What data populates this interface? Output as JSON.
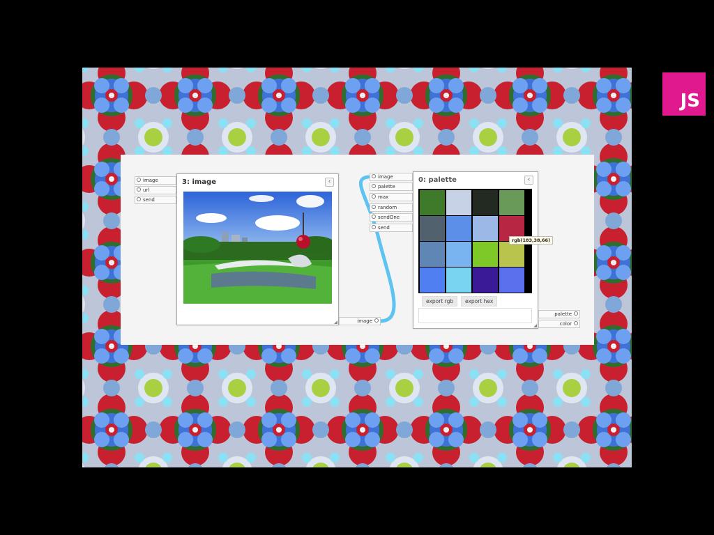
{
  "badge": {
    "label": "JS",
    "color": "#e01a8e"
  },
  "image_node": {
    "title": "3: image",
    "inputs": [
      "image",
      "url",
      "send"
    ],
    "outputs": [
      "image"
    ],
    "close_icon": "chevron-left-icon"
  },
  "palette_node": {
    "title": "0: palette",
    "inputs": [
      "image",
      "palette",
      "max",
      "random",
      "sendOne",
      "send"
    ],
    "outputs": [
      "palette",
      "color"
    ],
    "buttons": {
      "export_rgb": "export rgb",
      "export_hex": "export hex"
    },
    "close_icon": "chevron-left-icon",
    "tooltip": "rgb(183,38,66)",
    "swatches": [
      "#3e7a2a",
      "#c7d2e6",
      "#222a22",
      "#6a9a5a",
      "#52616e",
      "#5b8fe8",
      "#9cb8e6",
      "#b72642",
      "#5f86b4",
      "#7ab4f0",
      "#7ec828",
      "#b8c44c",
      "#4f7ff0",
      "#78d4f0",
      "#3a1a96",
      "#5a70ec"
    ]
  },
  "wire": {
    "color": "#5ec3f0"
  }
}
